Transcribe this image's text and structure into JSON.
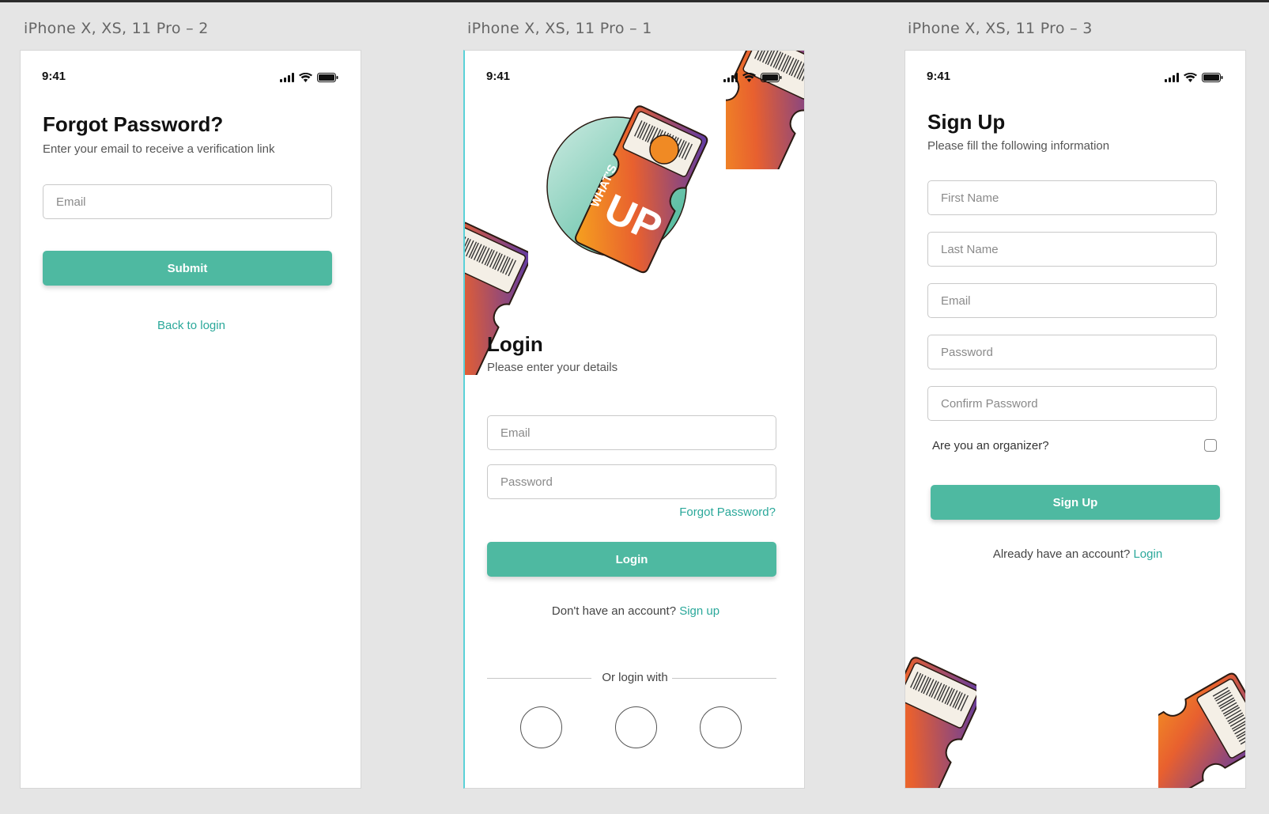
{
  "artboards": {
    "forgot": "iPhone X, XS, 11 Pro – 2",
    "login": "iPhone X, XS, 11 Pro – 1",
    "signup": "iPhone X, XS, 11 Pro – 3"
  },
  "status_time": "9:41",
  "forgot": {
    "title": "Forgot Password?",
    "subtitle": "Enter your email to receive a verification link",
    "email_placeholder": "Email",
    "submit_label": "Submit",
    "back_link": "Back to login"
  },
  "login": {
    "logo_text_small": "WHAT'S",
    "logo_text_big": "UP",
    "title": "Login",
    "subtitle": "Please enter your details",
    "email_placeholder": "Email",
    "password_placeholder": "Password",
    "forgot_link": "Forgot Password?",
    "login_label": "Login",
    "no_account_text": "Don't have an account?",
    "signup_link": "Sign up",
    "divider_text": "Or login with"
  },
  "signup": {
    "title": "Sign Up",
    "subtitle": "Please fill the following information",
    "first_name_placeholder": "First Name",
    "last_name_placeholder": "Last Name",
    "email_placeholder": "Email",
    "password_placeholder": "Password",
    "confirm_password_placeholder": "Confirm Password",
    "organizer_label": "Are you an organizer?",
    "signup_label": "Sign Up",
    "have_account_text": "Already have an account?",
    "login_link": "Login"
  },
  "colors": {
    "accent": "#4eb9a1",
    "link": "#2aa89a",
    "ticket_orange": "#f08a24",
    "ticket_purple": "#5a3aa8",
    "circle_teal": "#7fcfb8"
  }
}
